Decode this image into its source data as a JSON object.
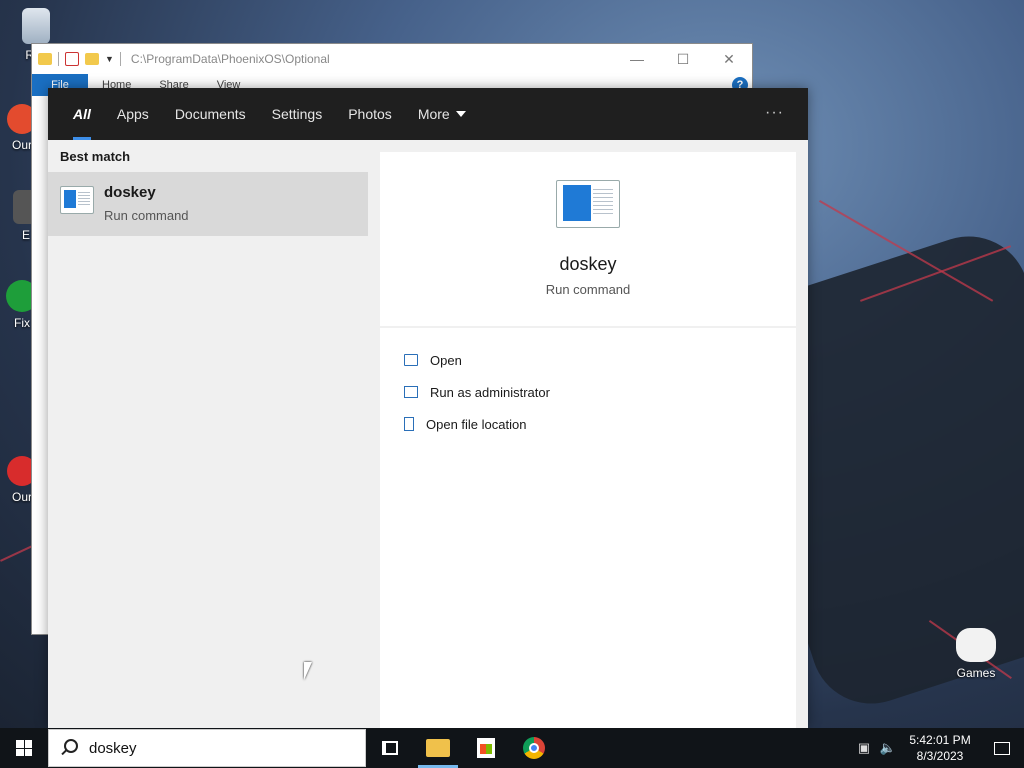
{
  "desktop": {
    "icons": [
      {
        "label": "Rec"
      },
      {
        "label": "Our"
      },
      {
        "label": "E"
      },
      {
        "label": "Fix"
      },
      {
        "label": "Our"
      },
      {
        "label": "Games"
      }
    ]
  },
  "explorer": {
    "path": "C:\\ProgramData\\PhoenixOS\\Optional",
    "ribbon_tabs": [
      "File",
      "Home",
      "Share",
      "View"
    ],
    "help": "?"
  },
  "search": {
    "tabs": [
      "All",
      "Apps",
      "Documents",
      "Settings",
      "Photos",
      "More"
    ],
    "active_tab": "All",
    "more_options": "···",
    "section_label": "Best match",
    "result": {
      "title": "doskey",
      "subtitle": "Run command"
    },
    "preview": {
      "title": "doskey",
      "subtitle": "Run command"
    },
    "actions": [
      "Open",
      "Run as administrator",
      "Open file location"
    ],
    "query": "doskey"
  },
  "taskbar": {
    "time": "5:42:01 PM",
    "date": "8/3/2023"
  },
  "colors": {
    "accent": "#3d8ee8",
    "header_bg": "#1f1f1f",
    "taskbar_bg": "#101418",
    "selection_bg": "#d9d9d9"
  }
}
